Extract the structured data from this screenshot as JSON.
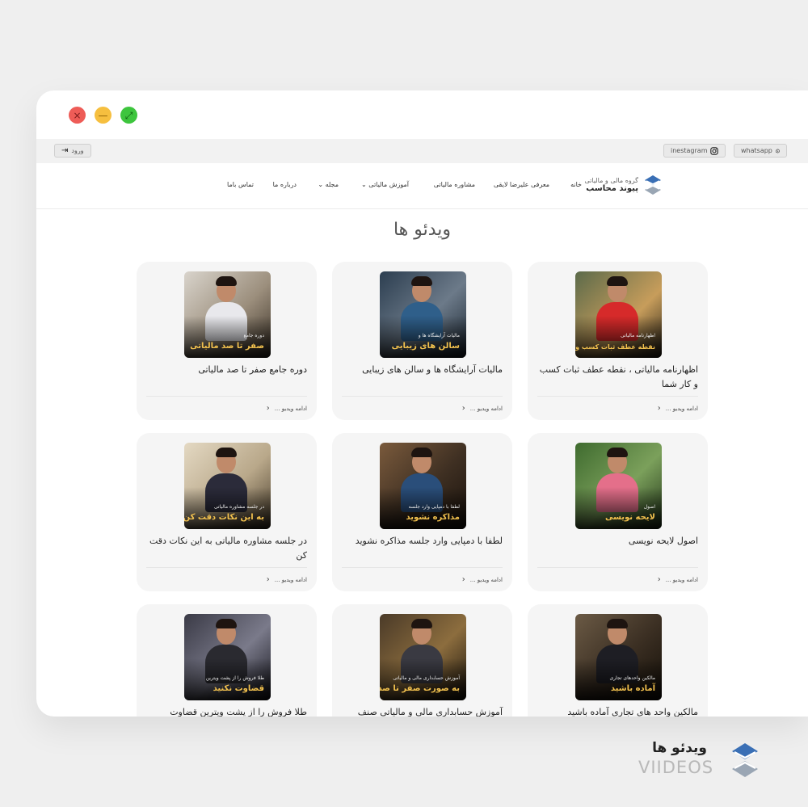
{
  "window": {
    "controls": [
      {
        "name": "close",
        "glyph": "×"
      },
      {
        "name": "minimize",
        "glyph": "—"
      },
      {
        "name": "maximize",
        "glyph": "⤢"
      }
    ]
  },
  "topbar": {
    "login_label": "ورود",
    "instagram_label": "inestagram",
    "whatsapp_label": "whatsapp"
  },
  "logo": {
    "subtitle": "گروه مالی و مالیاتی",
    "name": "پیوند محاسب"
  },
  "nav": {
    "home": "خانه",
    "intro": "معرفی علیرضا لایقی",
    "consult": "مشاوره مالیاتی",
    "education": "آموزش مالیاتی ⌄",
    "magazine": "مجله ⌄",
    "about": "درباره ما",
    "contact": "تماس باما"
  },
  "page": {
    "title": "ویدئو ها"
  },
  "read_more": "ادامه ویدیو ...",
  "cards": [
    {
      "title": "اظهارنامه مالیاتی ، نقطه عطف ثبات کسب و کار شما",
      "cap_small": "اظهارنامه مالیاتی",
      "cap_big": "نقطه عطف ثبات کسب و کار شما"
    },
    {
      "title": "مالیات آرایشگاه ها و سالن های زیبایی",
      "cap_small": "مالیات آرایشگاه ها و",
      "cap_big": "سالن های زیبایی"
    },
    {
      "title": "دوره جامع صفر تا صد مالیاتی",
      "cap_small": "دوره جامع",
      "cap_big": "صفر تا صد مالیاتی"
    },
    {
      "title": "اصول لایحه نویسی",
      "cap_small": "اصول",
      "cap_big": "لایحه نویسی"
    },
    {
      "title": "لطفا با دمپایی وارد جلسه مذاکره نشوید",
      "cap_small": "لطفا با دمپایی وارد جلسه",
      "cap_big": "مذاکره نشوید"
    },
    {
      "title": "در جلسه مشاوره مالیاتی به این نکات دقت کن",
      "cap_small": "در جلسه مشاوره مالیاتی",
      "cap_big": "به این نکات دقت کن"
    },
    {
      "title": "مالکین واحد های تجاری آماده باشید",
      "cap_small": "مالکین واحدهای تجاری",
      "cap_big": "آماده باشید"
    },
    {
      "title": "آموزش حسابداری مالی و مالیاتی صنف",
      "cap_small": "آموزش حسابداری مالی و مالیاتی",
      "cap_big": "به صورت صفر تا صد"
    },
    {
      "title": "طلا فروش را از پشت ویترین قضاوت",
      "cap_small": "طلا فروش را از پشت ویترین",
      "cap_big": "قضاوت نکنید"
    }
  ],
  "footer": {
    "title": "ویدئو ها",
    "subtitle": "VIIDEOS"
  },
  "colors": {
    "accent_gold": "#f2c14e",
    "logo_blue": "#3a6fb5",
    "card_bg": "#f5f5f5"
  }
}
